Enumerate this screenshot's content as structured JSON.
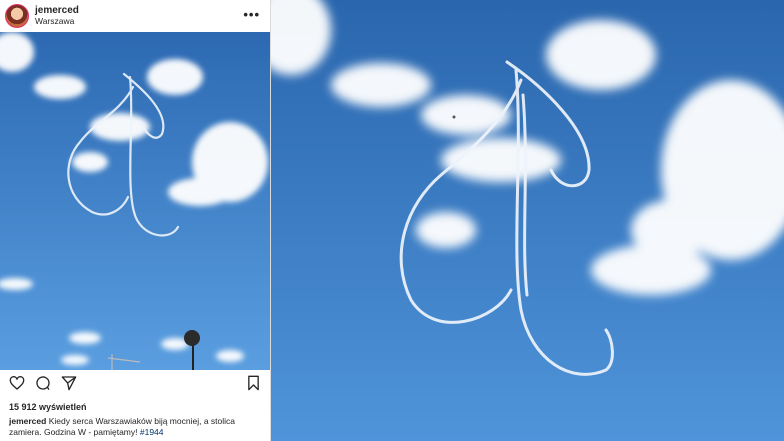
{
  "post": {
    "username": "jemerced",
    "location": "Warszawa",
    "more_label": "•••",
    "views": "15 912 wyświetleń",
    "caption_user": "jemerced",
    "caption_text": "Kiedy serca Warszawiaków biją mocniej, a stolica zamiera. Godzina W - pamiętamy!",
    "hashtag": "#1944"
  },
  "colors": {
    "sky_top": "#2f6fb8",
    "sky_bottom": "#4d93d9",
    "cloud": "#ffffff",
    "hashtag": "#003569"
  },
  "icons": [
    "heart-icon",
    "comment-icon",
    "share-icon",
    "bookmark-icon",
    "more-icon"
  ]
}
